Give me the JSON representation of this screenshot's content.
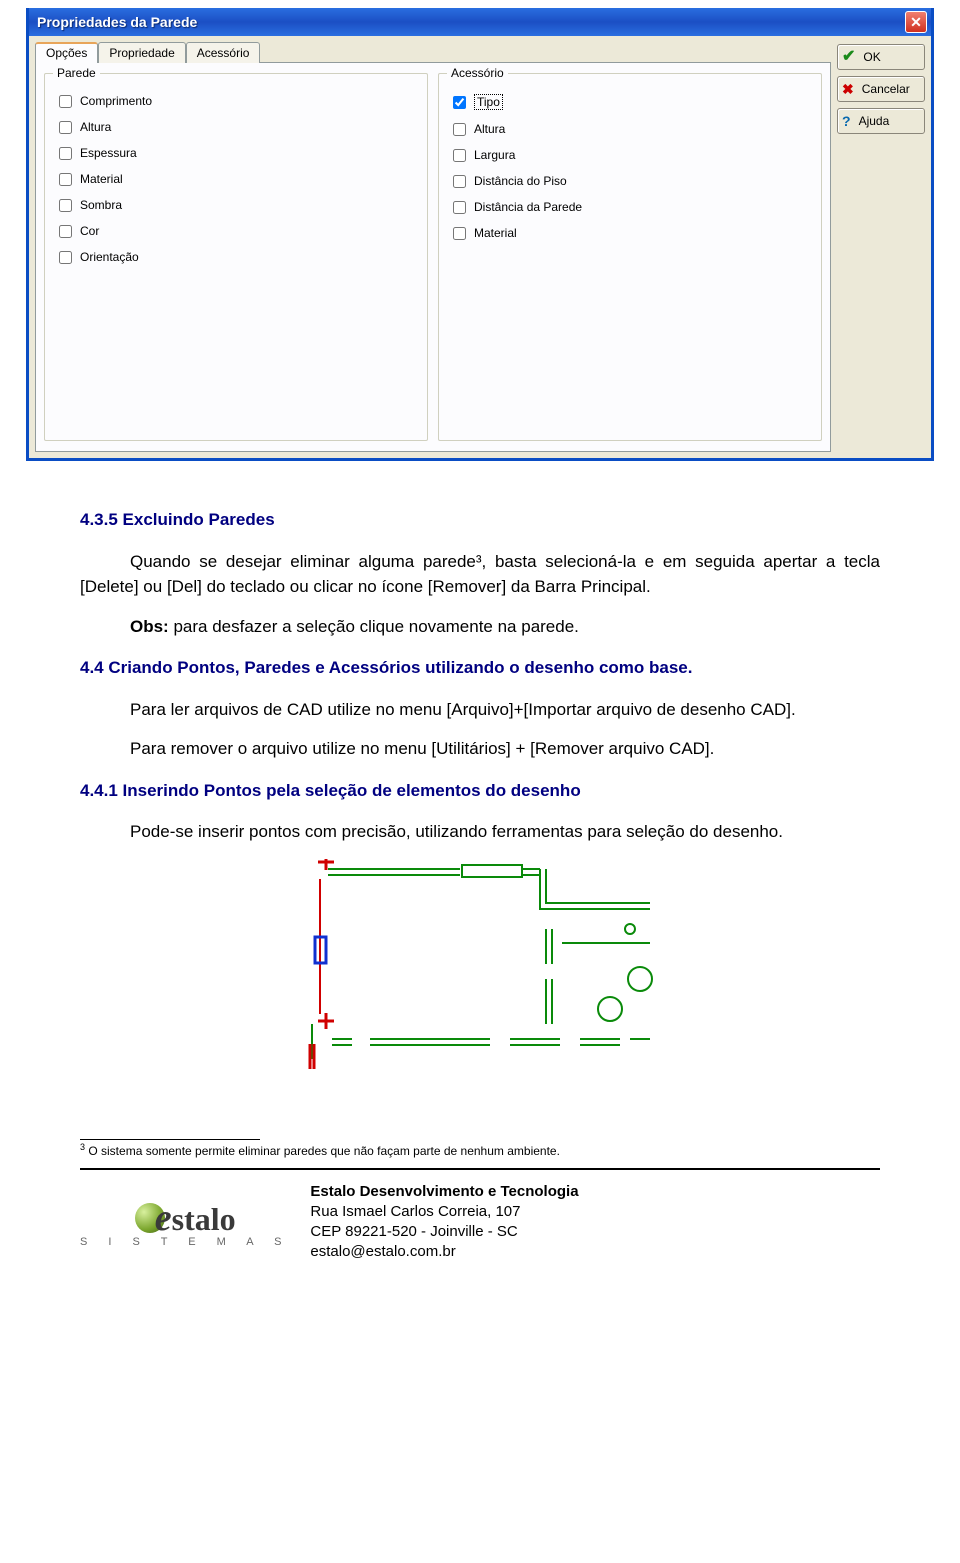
{
  "dialog": {
    "title": "Propriedades da Parede",
    "close_symbol": "✕",
    "tabs": [
      "Opções",
      "Propriedade",
      "Acessório"
    ],
    "group_parede": {
      "title": "Parede",
      "items": [
        "Comprimento",
        "Altura",
        "Espessura",
        "Material",
        "Sombra",
        "Cor",
        "Orientação"
      ]
    },
    "group_acessorio": {
      "title": "Acessório",
      "items": [
        "Tipo",
        "Altura",
        "Largura",
        "Distância do Piso",
        "Distância da Parede",
        "Material"
      ],
      "checked_index": 0
    },
    "buttons": {
      "ok": "OK",
      "cancel": "Cancelar",
      "help": "Ajuda"
    }
  },
  "doc": {
    "h435": "4.3.5 Excluindo Paredes",
    "p_excluir": "Quando se desejar eliminar alguma parede³, basta selecioná-la e em seguida apertar a tecla [Delete] ou [Del] do teclado ou clicar no ícone [Remover] da Barra Principal.",
    "p_obs_label": "Obs:",
    "p_obs_text": " para desfazer a seleção clique novamente na parede.",
    "h44": "4.4 Criando Pontos, Paredes e Acessórios utilizando o desenho como base.",
    "p_cad1": "Para ler arquivos de CAD utilize no menu [Arquivo]+[Importar arquivo de desenho CAD].",
    "p_cad2": "Para remover o arquivo utilize no menu [Utilitários] + [Remover arquivo CAD].",
    "h441": "4.4.1 Inserindo Pontos pela seleção de elementos do desenho",
    "p_inserir": "Pode-se inserir pontos com precisão, utilizando ferramentas para seleção do desenho."
  },
  "footnote": {
    "num": "3",
    "text": " O sistema somente permite eliminar paredes que não façam parte de nenhum ambiente."
  },
  "footer": {
    "logo_sub": "S I S T E M A S",
    "line1": "Estalo Desenvolvimento e Tecnologia",
    "line2": "Rua Ismael Carlos Correia, 107",
    "line3": "CEP 89221-520 - Joinville - SC",
    "line4": "estalo@estalo.com.br"
  }
}
